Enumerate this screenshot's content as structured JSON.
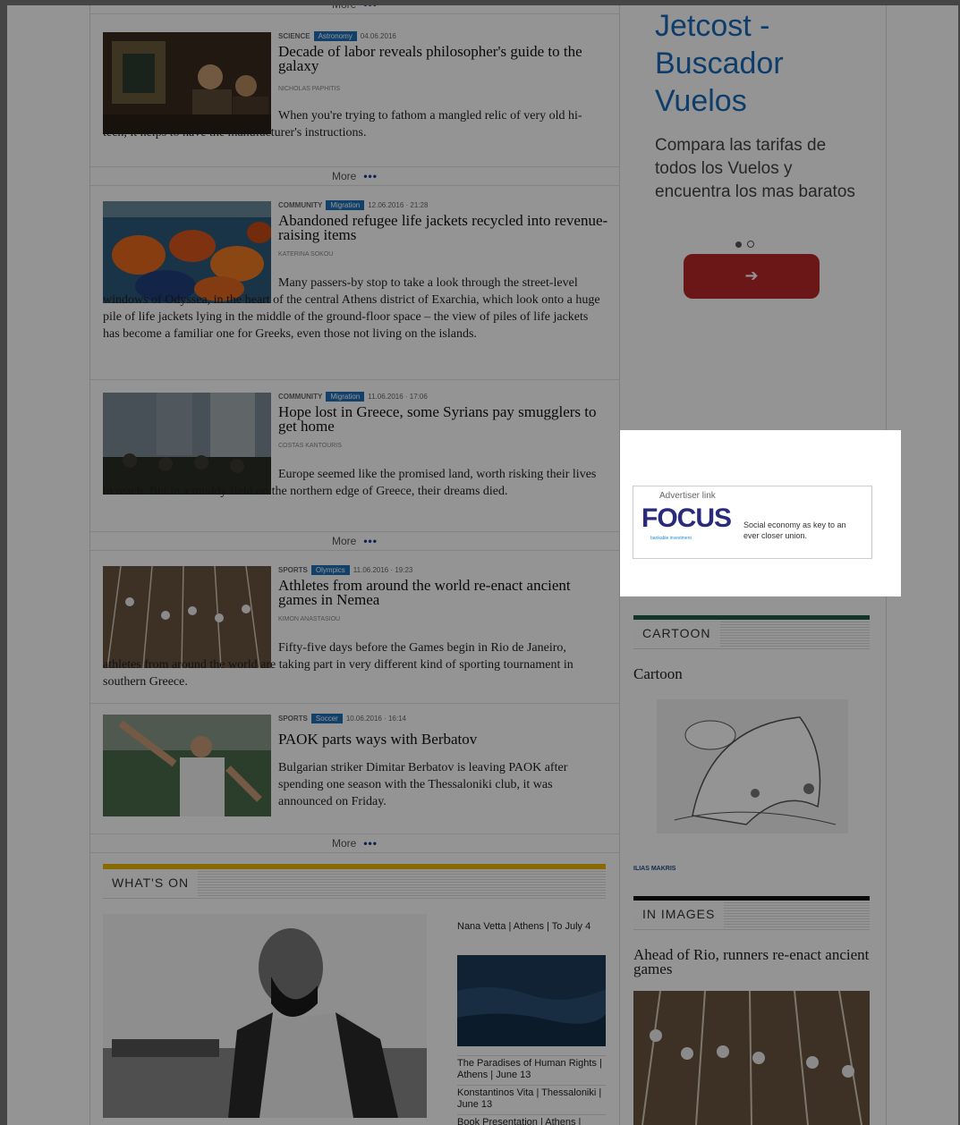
{
  "articles": [
    {
      "section": "SCIENCE",
      "tag": "Astronomy",
      "date": "04.06.2016",
      "headline": "Decade of labor reveals philosopher's guide to the galaxy",
      "byline": "NICHOLAS PAPHITIS",
      "summary": "When you're trying to fathom a mangled relic of very old hi-tech, it helps to have the manufacturer's instructions."
    },
    {
      "section": "COMMUNITY",
      "tag": "Migration",
      "date": "12.06.2016 · 21:28",
      "headline": "Abandoned refugee life jackets recycled into revenue-raising items",
      "byline": "KATERINA SOKOU",
      "summary": "Many passers-by stop to take a look through the street-level windows of Odyssea, in the heart of the central Athens district of Exarchia, which look onto a huge pile of life jackets lying in the middle of the ground-floor space – the view of piles of life jackets has become a familiar one for Greeks, even those not living on the islands."
    },
    {
      "section": "COMMUNITY",
      "tag": "Migration",
      "date": "11.06.2016 · 17:06",
      "headline": "Hope lost in Greece, some Syrians pay smugglers to get home",
      "byline": "COSTAS KANTOURIS",
      "summary": "Europe seemed like the promised land, worth risking their lives to reach. But in a muddy field on the northern edge of Greece, their dreams died."
    },
    {
      "section": "SPORTS",
      "tag": "Olympics",
      "date": "11.06.2016 · 19:23",
      "headline": "Athletes from around the world re-enact ancient games in Nemea",
      "byline": "KIMON ANASTASIOU",
      "summary": "Fifty-five days before the Games begin in Rio de Janeiro, athletes from around the world are taking part in very different kind of sporting tournament in southern Greece."
    },
    {
      "section": "SPORTS",
      "tag": "Soccer",
      "date": "10.06.2016 · 16:14",
      "headline": "PAOK parts ways with Berbatov",
      "byline": "",
      "summary": "Bulgarian striker Dimitar Berbatov is leaving PAOK after spending one season with the Thessaloniki club, it was announced on Friday."
    }
  ],
  "more_label": "More",
  "more_dots": "•••",
  "whats_on": {
    "title": "WHAT'S ON",
    "items": [
      "Nana Vetta | Athens | To July 4",
      "The Paradises of Human Rights | Athens | June 13",
      "Konstantinos Vita | Thessaloniki | June 13",
      "Book Presentation | Athens |"
    ]
  },
  "ad_top": {
    "title": "Jetcost - Buscador Vuelos",
    "text": "Compara las tarifas de todos los Vuelos y encuentra los mas baratos",
    "arrow": "➔"
  },
  "advertiser": {
    "label": "Advertiser link",
    "brand": "FOCUS",
    "brand_sub": "bankable investment",
    "text": "Social economy as key to an ever closer union."
  },
  "cartoon": {
    "header": "CARTOON",
    "title": "Cartoon",
    "credit": "ILIAS MAKRIS"
  },
  "in_images": {
    "header": "IN IMAGES",
    "title": "Ahead of Rio, runners re-enact ancient games"
  },
  "colors": {
    "accent_blue": "#1e6fb8",
    "ad_red": "#b8282a",
    "whatson_yellow": "#e8b800",
    "cartoon_green": "#1f5a4a"
  }
}
